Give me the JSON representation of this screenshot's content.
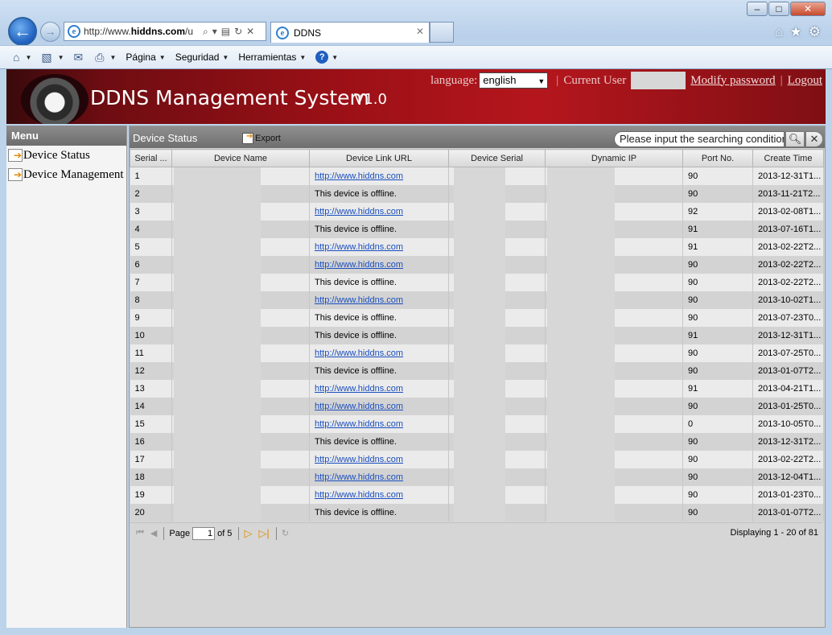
{
  "browser": {
    "address": "http://www.hiddns.com/u",
    "address_prefix": "http://www.",
    "address_domain": "hiddns.com",
    "address_suffix": "/u",
    "tab_title": "DDNS",
    "menus": [
      "Página",
      "Seguridad",
      "Herramientas"
    ]
  },
  "app": {
    "title": "DDNS Management System",
    "version": "V1.0",
    "language_label": "language:",
    "language_value": "english",
    "current_user_label": "Current User",
    "modify_password": "Modify password",
    "logout": "Logout"
  },
  "menu": {
    "title": "Menu",
    "items": [
      "Device Status",
      "Device Management"
    ]
  },
  "panel": {
    "title": "Device Status",
    "export_label": "Export",
    "search_placeholder": "Please input the searching condition"
  },
  "table": {
    "columns": [
      "Serial ...",
      "Device Name",
      "Device Link URL",
      "Device Serial",
      "Dynamic IP",
      "Port No.",
      "Create Time"
    ],
    "link_text": "http://www.hiddns.com",
    "offline_text": "This device is offline.",
    "rows": [
      {
        "serial": "1",
        "online": true,
        "port": "90",
        "created": "2013-12-31T1..."
      },
      {
        "serial": "2",
        "online": false,
        "port": "90",
        "created": "2013-11-21T2..."
      },
      {
        "serial": "3",
        "online": true,
        "port": "92",
        "created": "2013-02-08T1..."
      },
      {
        "serial": "4",
        "online": false,
        "port": "91",
        "created": "2013-07-16T1..."
      },
      {
        "serial": "5",
        "online": true,
        "port": "91",
        "created": "2013-02-22T2..."
      },
      {
        "serial": "6",
        "online": true,
        "port": "90",
        "created": "2013-02-22T2..."
      },
      {
        "serial": "7",
        "online": false,
        "port": "90",
        "created": "2013-02-22T2..."
      },
      {
        "serial": "8",
        "online": true,
        "port": "90",
        "created": "2013-10-02T1..."
      },
      {
        "serial": "9",
        "online": false,
        "port": "90",
        "created": "2013-07-23T0..."
      },
      {
        "serial": "10",
        "online": false,
        "port": "91",
        "created": "2013-12-31T1..."
      },
      {
        "serial": "11",
        "online": true,
        "port": "90",
        "created": "2013-07-25T0..."
      },
      {
        "serial": "12",
        "online": false,
        "port": "90",
        "created": "2013-01-07T2..."
      },
      {
        "serial": "13",
        "online": true,
        "port": "91",
        "created": "2013-04-21T1..."
      },
      {
        "serial": "14",
        "online": true,
        "port": "90",
        "created": "2013-01-25T0..."
      },
      {
        "serial": "15",
        "online": true,
        "port": "0",
        "created": "2013-10-05T0..."
      },
      {
        "serial": "16",
        "online": false,
        "port": "90",
        "created": "2013-12-31T2..."
      },
      {
        "serial": "17",
        "online": true,
        "port": "90",
        "created": "2013-02-22T2..."
      },
      {
        "serial": "18",
        "online": true,
        "port": "90",
        "created": "2013-12-04T1..."
      },
      {
        "serial": "19",
        "online": true,
        "port": "90",
        "created": "2013-01-23T0..."
      },
      {
        "serial": "20",
        "online": false,
        "port": "90",
        "created": "2013-01-07T2..."
      }
    ]
  },
  "pager": {
    "page_label": "Page",
    "current_page": "1",
    "of_label": "of 5",
    "display_info": "Displaying 1 - 20 of 81"
  }
}
